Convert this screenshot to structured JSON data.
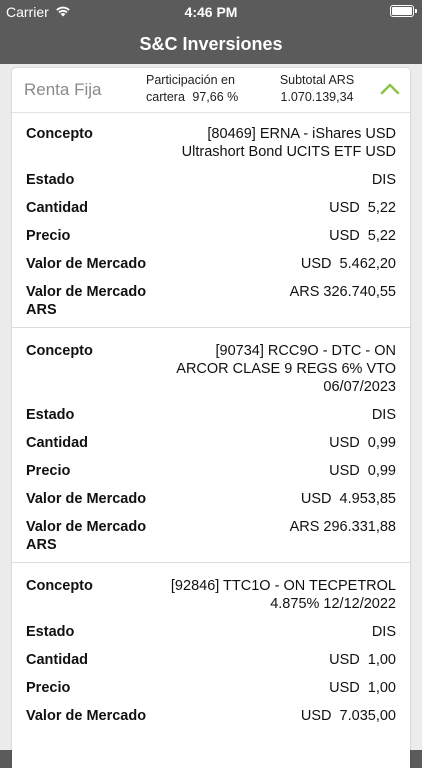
{
  "status_bar": {
    "carrier": "Carrier",
    "time": "4:46 PM"
  },
  "nav": {
    "title": "S&C Inversiones"
  },
  "section": {
    "title": "Renta Fija",
    "participation_label": "Participación en cartera",
    "participation_value": "97,66 %",
    "subtotal_label": "Subtotal ARS",
    "subtotal_value": "1.070.139,34"
  },
  "labels": {
    "concepto": "Concepto",
    "estado": "Estado",
    "cantidad": "Cantidad",
    "precio": "Precio",
    "valor_mercado": "Valor de Mercado",
    "valor_mercado_ars": "Valor de Mercado ARS"
  },
  "items": [
    {
      "concepto": "[80469] ERNA - iShares USD Ultrashort Bond UCITS ETF USD",
      "estado": "DIS",
      "cantidad": "USD  5,22",
      "precio": "USD  5,22",
      "valor_mercado": "USD  5.462,20",
      "valor_mercado_ars": "ARS 326.740,55"
    },
    {
      "concepto": "[90734] RCC9O - DTC - ON ARCOR CLASE 9 REGS 6% VTO 06/07/2023",
      "estado": "DIS",
      "cantidad": "USD  0,99",
      "precio": "USD  0,99",
      "valor_mercado": "USD  4.953,85",
      "valor_mercado_ars": "ARS 296.331,88"
    },
    {
      "concepto": "[92846] TTC1O - ON TECPETROL 4.875% 12/12/2022",
      "estado": "DIS",
      "cantidad": "USD  1,00",
      "precio": "USD  1,00",
      "valor_mercado": "USD  7.035,00"
    }
  ],
  "colors": {
    "nav_background": "#5b5b5b",
    "chevron": "#8bc34a"
  }
}
